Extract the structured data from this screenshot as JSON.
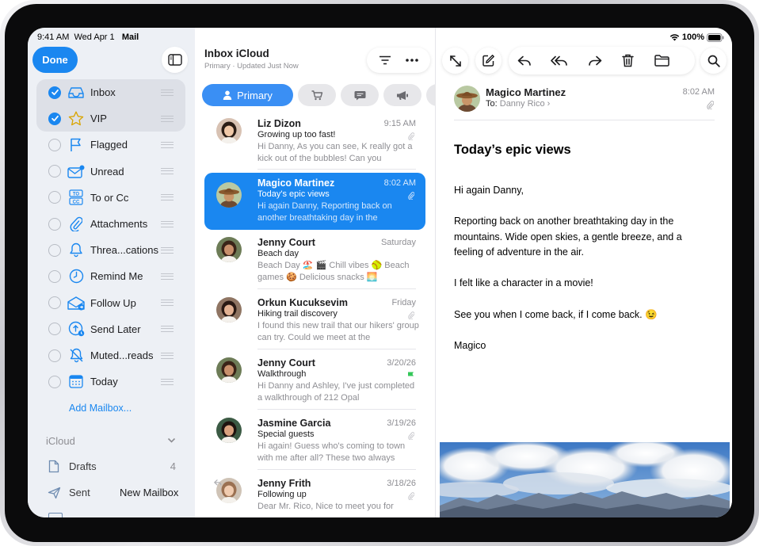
{
  "status": {
    "time": "9:41 AM",
    "date": "Wed Apr 1",
    "app": "Mail",
    "battery": "100%"
  },
  "sidebar": {
    "done_label": "Done",
    "mailboxes": [
      {
        "label": "Inbox",
        "icon": "tray-icon",
        "checked": true
      },
      {
        "label": "VIP",
        "icon": "star-icon",
        "checked": true
      },
      {
        "label": "Flagged",
        "icon": "flag-icon",
        "checked": false
      },
      {
        "label": "Unread",
        "icon": "envelope-badge-icon",
        "checked": false
      },
      {
        "label": "To or Cc",
        "icon": "to-cc-icon",
        "checked": false
      },
      {
        "label": "Attachments",
        "icon": "paperclip-icon",
        "checked": false
      },
      {
        "label": "Threa...cations",
        "icon": "bell-icon",
        "checked": false
      },
      {
        "label": "Remind Me",
        "icon": "clock-icon",
        "checked": false
      },
      {
        "label": "Follow Up",
        "icon": "envelope-arrow-icon",
        "checked": false
      },
      {
        "label": "Send Later",
        "icon": "clock-arrow-icon",
        "checked": false
      },
      {
        "label": "Muted...reads",
        "icon": "bell-slash-icon",
        "checked": false
      },
      {
        "label": "Today",
        "icon": "calendar-icon",
        "checked": false
      }
    ],
    "add_mailbox": "Add Mailbox...",
    "account": "iCloud",
    "folders": [
      {
        "label": "Drafts",
        "count": "4"
      },
      {
        "label": "Sent",
        "count": ""
      }
    ],
    "new_mailbox": "New Mailbox"
  },
  "list": {
    "title": "Inbox iCloud",
    "subtitle": "Primary · Updated Just Now",
    "primary_tab": "Primary",
    "messages": [
      {
        "sender": "Liz Dizon",
        "date": "9:15 AM",
        "subject": "Growing up too fast!",
        "preview": "Hi Danny, As you can see, K really got a kick out of the bubbles! Can you",
        "clip": true
      },
      {
        "sender": "Magico Martinez",
        "date": "8:02 AM",
        "subject": "Today's epic views",
        "preview": "Hi again Danny, Reporting back on another breathtaking day in the",
        "clip": true
      },
      {
        "sender": "Jenny Court",
        "date": "Saturday",
        "subject": "Beach day",
        "preview": "Beach Day 🏖️ 🎬 Chill vibes 🥎 Beach games 🍪 Delicious snacks 🌅",
        "clip": false
      },
      {
        "sender": "Orkun Kucuksevim",
        "date": "Friday",
        "subject": "Hiking trail discovery",
        "preview": "I found this new trail that our hikers' group can try. Could we meet at the",
        "clip": true
      },
      {
        "sender": "Jenny Court",
        "date": "3/20/26",
        "subject": "Walkthrough",
        "preview": "Hi Danny and Ashley, I've just completed a walkthrough of 212 Opal",
        "clip": false,
        "flag": true
      },
      {
        "sender": "Jasmine Garcia",
        "date": "3/19/26",
        "subject": "Special guests",
        "preview": "Hi again! Guess who's coming to town with me after all? These two always",
        "clip": true
      },
      {
        "sender": "Jenny Frith",
        "date": "3/18/26",
        "subject": "Following up",
        "preview": "Dear Mr. Rico, Nice to meet you for",
        "clip": true
      }
    ]
  },
  "reader": {
    "sender": "Magico Martinez",
    "to_label": "To:",
    "to_name": "Danny Rico",
    "time": "8:02 AM",
    "subject": "Today’s epic views",
    "body": [
      "Hi again Danny,",
      "Reporting back on another breathtaking day in the mountains. Wide open skies, a gentle breeze, and a feeling of adventure in the air.",
      "I felt like a character in a movie!",
      "See you when I come back, if I come back. 😉",
      "Magico"
    ]
  },
  "colors": {
    "accent": "#1a87f0",
    "sidebar_bg": "#edf0f5",
    "selected_row": "#1a87f0"
  }
}
